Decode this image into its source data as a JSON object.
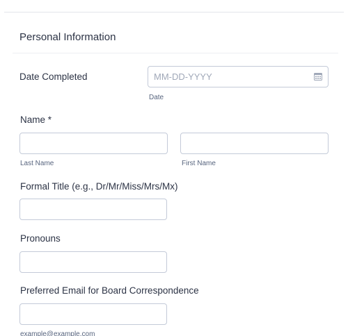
{
  "section": {
    "title": "Personal Information"
  },
  "date_completed": {
    "label": "Date Completed",
    "placeholder": "MM-DD-YYYY",
    "sublabel": "Date"
  },
  "name": {
    "label": "Name *",
    "last_sublabel": "Last Name",
    "first_sublabel": "First Name"
  },
  "formal_title": {
    "label": "Formal Title (e.g., Dr/Mr/Miss/Mrs/Mx)"
  },
  "pronouns": {
    "label": "Pronouns"
  },
  "email": {
    "label": "Preferred Email for Board Correspondence",
    "sublabel": "example@example.com"
  },
  "colors": {
    "border": "#c3cad8",
    "text": "#2c3345",
    "sublabel": "#57647e",
    "placeholder": "#a0a8b8"
  }
}
